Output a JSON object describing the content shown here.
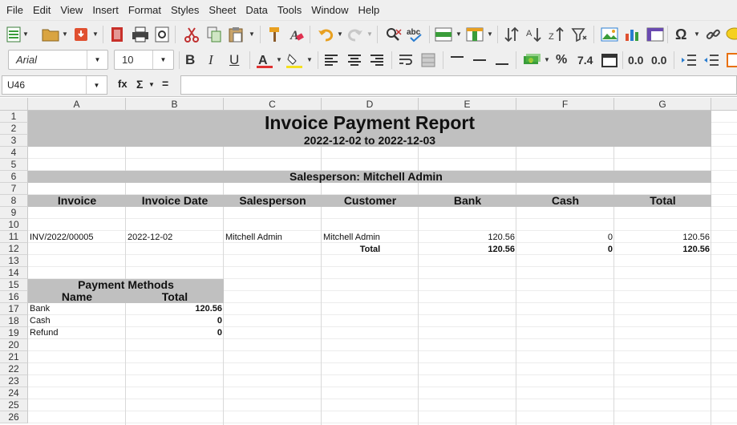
{
  "menu": [
    "File",
    "Edit",
    "View",
    "Insert",
    "Format",
    "Styles",
    "Sheet",
    "Data",
    "Tools",
    "Window",
    "Help"
  ],
  "toolbar": {
    "font_name": "Arial",
    "font_size": "10",
    "bold": "B",
    "italic": "I",
    "underline": "U",
    "percent": "%",
    "decimal": "7.4",
    "add_decimal": "0.0",
    "remove_decimal": "0.0",
    "omega": "Ω"
  },
  "formula_bar": {
    "cell_ref": "U46",
    "fx": "fx",
    "sigma": "Σ",
    "equals": "="
  },
  "columns": [
    "A",
    "B",
    "C",
    "D",
    "E",
    "F",
    "G"
  ],
  "rows": [
    "1",
    "2",
    "3",
    "4",
    "5",
    "6",
    "7",
    "8",
    "9",
    "10",
    "11",
    "12",
    "13",
    "14",
    "15",
    "16",
    "17",
    "18",
    "19",
    "20",
    "21",
    "22",
    "23",
    "24",
    "25",
    "26"
  ],
  "report": {
    "title": "Invoice Payment Report",
    "date_range": "2022-12-02 to 2022-12-03",
    "salesperson_heading": "Salesperson: Mitchell Admin",
    "headers": [
      "Invoice",
      "Invoice Date",
      "Salesperson",
      "Customer",
      "Bank",
      "Cash",
      "Total"
    ],
    "row": {
      "invoice": "INV/2022/00005",
      "date": "2022-12-02",
      "salesperson": "Mitchell Admin",
      "customer": "Mitchell Admin",
      "bank": "120.56",
      "cash": "0",
      "total": "120.56"
    },
    "totals": {
      "label": "Total",
      "bank": "120.56",
      "cash": "0",
      "total": "120.56"
    },
    "payment_methods": {
      "title": "Payment Methods",
      "name_header": "Name",
      "total_header": "Total",
      "items": [
        {
          "name": "Bank",
          "total": "120.56"
        },
        {
          "name": "Cash",
          "total": "0"
        },
        {
          "name": "Refund",
          "total": "0"
        }
      ]
    }
  },
  "colors": {
    "band": "#c0c0c0",
    "ui_bg": "#efefef"
  }
}
